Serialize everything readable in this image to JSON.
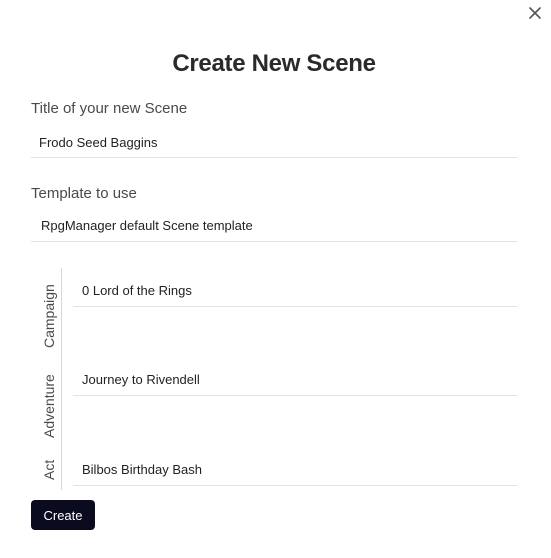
{
  "dialog": {
    "title": "Create New Scene",
    "close_icon": "close-icon"
  },
  "form": {
    "title_label": "Title of your new Scene",
    "title_value": "Frodo Seed Baggins",
    "template_label": "Template to use",
    "template_value": "RpgManager default Scene template"
  },
  "hierarchy": {
    "campaign_label": "Campaign",
    "campaign_value": "0 Lord of the Rings",
    "adventure_label": "Adventure",
    "adventure_value": "Journey to Rivendell",
    "act_label": "Act",
    "act_value": "Bilbos Birthday Bash"
  },
  "actions": {
    "create_label": "Create"
  },
  "colors": {
    "button_bg": "#0b0b20",
    "divider": "#e2e2e2"
  }
}
